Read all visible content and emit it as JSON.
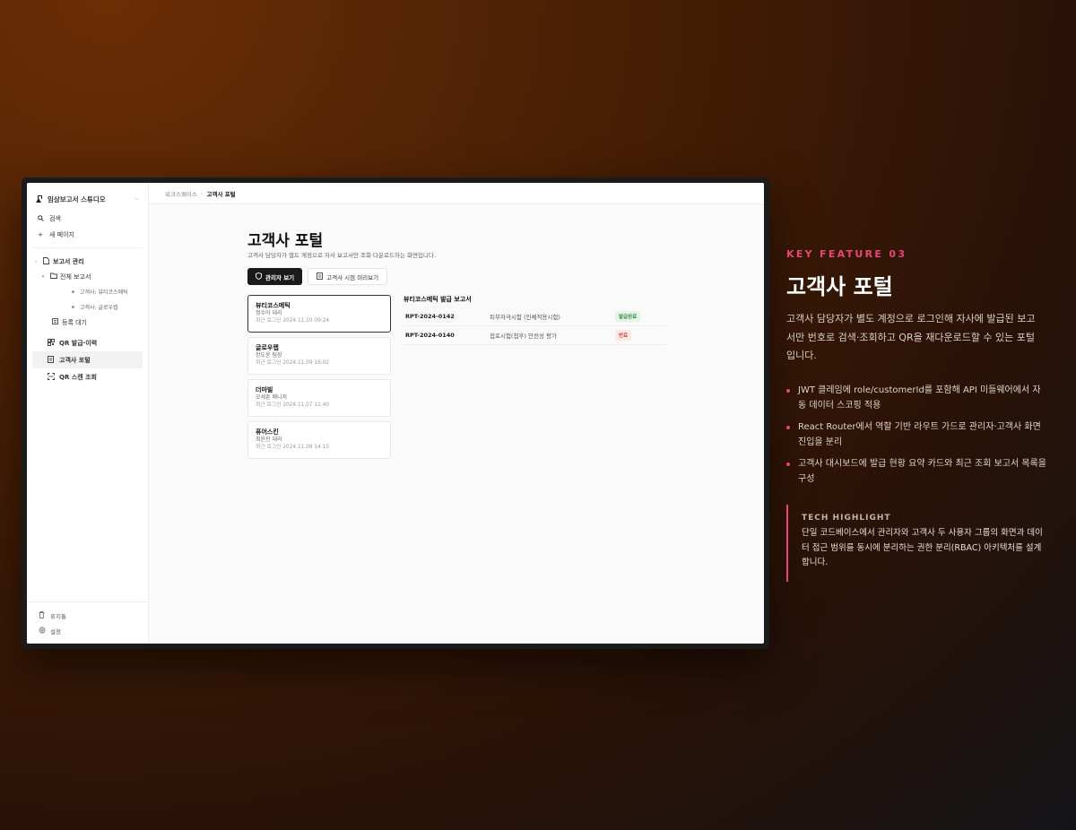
{
  "app": {
    "workspace_name": "임상보고서 스튜디오",
    "sidebar": {
      "search_label": "검색",
      "new_page_label": "새 페이지",
      "tree": {
        "root_label": "보고서 관리",
        "folder_label": "전체 보고서",
        "leaves": [
          "고객사: 뷰티코스메틱",
          "고객사: 글로우랩"
        ],
        "pending_label": "등록 대기"
      },
      "nav": [
        {
          "label": "QR 발급·이력",
          "icon": "qr-icon"
        },
        {
          "label": "고객사 포털",
          "icon": "document-icon"
        },
        {
          "label": "QR 스캔 조회",
          "icon": "scan-icon"
        }
      ],
      "bottom": [
        {
          "label": "휴지통",
          "icon": "trash-icon"
        },
        {
          "label": "설정",
          "icon": "gear-icon"
        }
      ]
    },
    "breadcrumb": {
      "parent": "워크스페이스",
      "current": "고객사 포털"
    },
    "page": {
      "title": "고객사 포털",
      "subtitle": "고객사 담당자가 별도 계정으로 자사 보고서만 조회·다운로드하는 화면입니다.",
      "view_admin_label": "관리자 보기",
      "view_client_label": "고객사 시점 미리보기"
    },
    "customers": [
      {
        "name": "뷰티코스메틱",
        "contact": "정수아 대리",
        "last_login": "최근 로그인 2024.11.10 09:24"
      },
      {
        "name": "글로우랩",
        "contact": "한도윤 팀장",
        "last_login": "최근 로그인 2024.11.09 16:02"
      },
      {
        "name": "더마빌",
        "contact": "오세훈 매니저",
        "last_login": "최근 로그인 2024.11.07 11:40"
      },
      {
        "name": "퓨어스킨",
        "contact": "최윤진 대리",
        "last_login": "최근 로그인 2024.11.08 14:15"
      }
    ],
    "reports_panel": {
      "title": "뷰티코스메틱 발급 보고서",
      "rows": [
        {
          "no": "RPT-2024-0142",
          "name": "피부자극시험 (인체적용시험)",
          "status": "발급완료",
          "status_color": "#2e8b47"
        },
        {
          "no": "RPT-2024-0140",
          "name": "첩포시험(첩후) 안전성 평가",
          "status": "반료",
          "status_color": "#d14242"
        }
      ]
    }
  },
  "feature": {
    "kicker": "KEY FEATURE 03",
    "title": "고객사 포털",
    "description": "고객사 담당자가 별도 계정으로 로그인해 자사에 발급된 보고서만 번호로 검색·조회하고 QR을 재다운로드할 수 있는 포털입니다.",
    "bullets": [
      "JWT 클레임에 role/customerId를 포함해 API 미들웨어에서 자동 데이터 스코핑 적용",
      "React Router에서 역할 기반 라우트 가드로 관리자·고객사 화면 진입을 분리",
      "고객사 대시보드에 발급 현황 요약 카드와 최근 조회 보고서 목록을 구성"
    ],
    "tech_label": "TECH HIGHLIGHT",
    "tech_text": "단일 코드베이스에서 관리자와 고객사 두 사용자 그룹의 화면과 데이터 접근 범위를 동시에 분리하는 권한 분리(RBAC) 아키텍처를 설계합니다.",
    "accent_color": "#e8457a"
  }
}
